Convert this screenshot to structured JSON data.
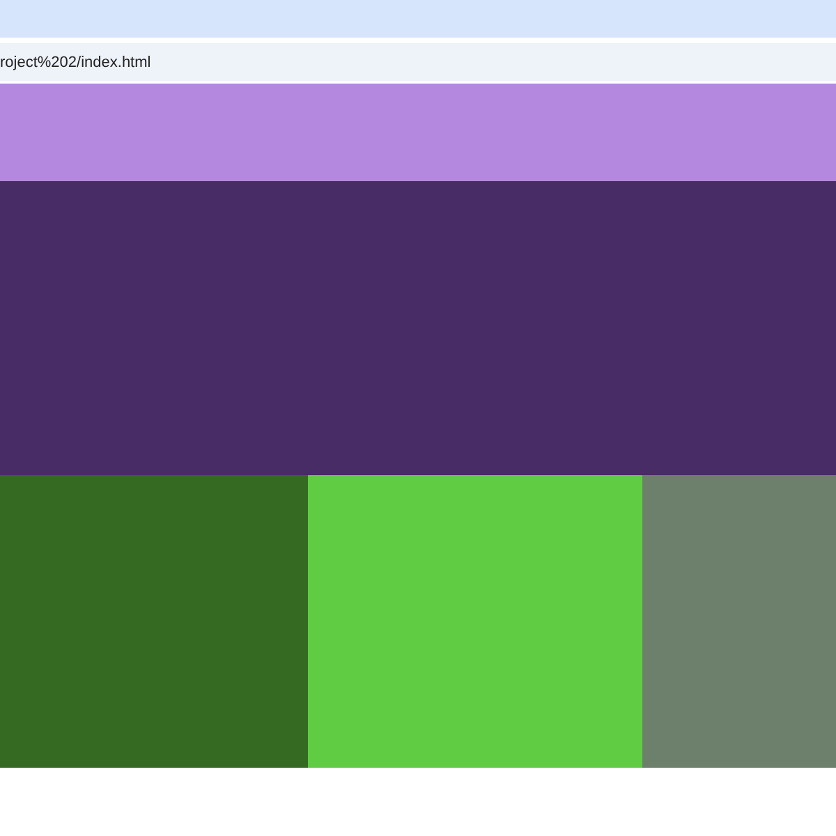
{
  "address_bar": {
    "url": "roject%202/index.html"
  },
  "page": {
    "bands": [
      {
        "color": "#b388de"
      },
      {
        "color": "#472c66"
      }
    ],
    "row": [
      {
        "color": "#356a22"
      },
      {
        "color": "#60cc44"
      },
      {
        "color": "#6c806b"
      }
    ]
  }
}
